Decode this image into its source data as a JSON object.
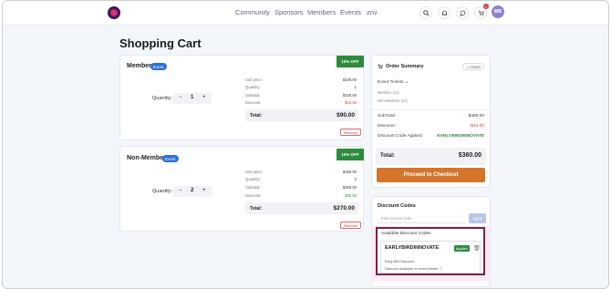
{
  "nav": {
    "items": [
      "Community",
      "Sponsors",
      "Members",
      "Events",
      "znv"
    ],
    "notif_count": "1",
    "avatar_initials": "MB"
  },
  "page_title": "Shopping Cart",
  "items": [
    {
      "name": "Member",
      "tag": "Event",
      "discount_badge": "10% OFF",
      "quantity_label": "Quantity:",
      "quantity": "1",
      "minus": "−",
      "plus": "+",
      "unit_price_label": "Unit price:",
      "unit_price": "$100.00",
      "quantity_row_label": "Quantity:",
      "quantity_row": "1",
      "subtotal_label": "Subtotal:",
      "subtotal": "$100.00",
      "discount_label": "Discount:",
      "discount": "$10.00",
      "total_label": "Total:",
      "total": "$90.00",
      "remove": "Remove"
    },
    {
      "name": "Non-Member",
      "tag": "Event",
      "discount_badge": "10% OFF",
      "quantity_label": "Quantity:",
      "quantity": "2",
      "minus": "−",
      "plus": "+",
      "unit_price_label": "Unit price:",
      "unit_price": "$150.00",
      "quantity_row_label": "Quantity:",
      "quantity_row": "2",
      "subtotal_label": "Subtotal:",
      "subtotal": "$300.00",
      "discount_label": "Discount:",
      "discount": "$30.00",
      "total_label": "Total:",
      "total": "$270.00",
      "remove": "Remove"
    }
  ],
  "summary": {
    "title": "Order Summary",
    "items_count": "2 ITEMS",
    "section": "Event Tickets",
    "lines": [
      "Member (x1)",
      "Non-Member (x2)"
    ],
    "subtotal_label": "SubTotal:",
    "subtotal": "$400.00",
    "discount_label": "Discount:",
    "discount": "-$40.00",
    "code_label": "Discount Code Applied:",
    "code": "EARLYBIRDINNOVATE",
    "total_label": "Total:",
    "total": "$360.00",
    "checkout": "Proceed to Checkout"
  },
  "discount_codes": {
    "title": "Discount Codes",
    "placeholder": "Enter promo code",
    "apply": "Apply",
    "available_title": "Available Discount Codes",
    "code": "EARLYBIRDINNOVATE",
    "applied": "Applied",
    "desc": "Early Bird Discount",
    "note": "Discount available on event tickets"
  },
  "colors": {
    "accent": "#d4752a",
    "badge_green": "#2e8b3e",
    "tag_blue": "#2f6fdd",
    "highlight_border": "#7a2145"
  }
}
